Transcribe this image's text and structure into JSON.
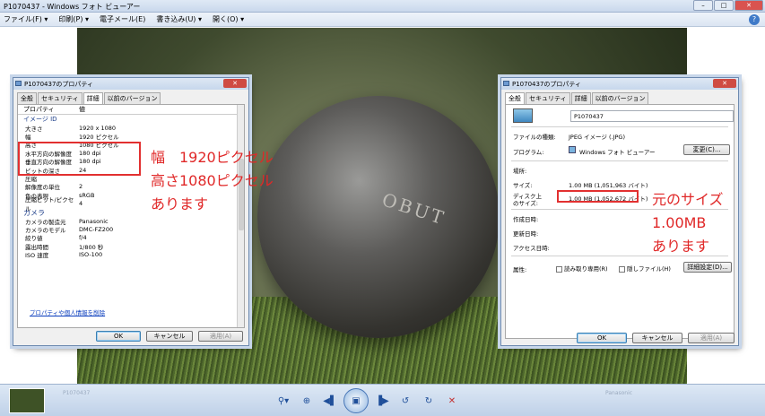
{
  "window": {
    "title": "P1070437 - Windows フォト ビューアー"
  },
  "menu": [
    {
      "label": "ファイル(F) ▾"
    },
    {
      "label": "印刷(P) ▾"
    },
    {
      "label": "電子メール(E)"
    },
    {
      "label": "書き込み(U) ▾"
    },
    {
      "label": "開く(O) ▾"
    }
  ],
  "dialog_left": {
    "title": "P1070437のプロパティ",
    "tabs": [
      "全般",
      "セキュリティ",
      "詳細",
      "以前のバージョン"
    ],
    "active_tab": 2,
    "header": {
      "property": "プロパティ",
      "value": "値"
    },
    "rows": [
      {
        "section": "イメージ ID"
      },
      {
        "name": "大きさ",
        "value": "1920 x 1080"
      },
      {
        "name": "幅",
        "value": "1920 ピクセル"
      },
      {
        "name": "高さ",
        "value": "1080 ピクセル"
      },
      {
        "name": "水平方向の解像度",
        "value": "180 dpi"
      },
      {
        "name": "垂直方向の解像度",
        "value": "180 dpi"
      },
      {
        "name": "ビットの深さ",
        "value": "24"
      },
      {
        "name": "圧縮",
        "value": ""
      },
      {
        "name": "解像度の単位",
        "value": "2"
      },
      {
        "name": "色の表現",
        "value": "sRGB"
      },
      {
        "name": "圧縮ビット/ピクセル",
        "value": "4"
      },
      {
        "camera": "カメラ"
      },
      {
        "name": "カメラの製造元",
        "value": "Panasonic"
      },
      {
        "name": "カメラのモデル",
        "value": "DMC-FZ200"
      },
      {
        "name": "絞り値",
        "value": "f/4"
      },
      {
        "name": "露出時間",
        "value": "1/800 秒"
      },
      {
        "name": "ISO 速度",
        "value": "ISO-100"
      }
    ],
    "privacy_link": "プロパティや個人情報を削除",
    "ok": "OK",
    "cancel": "キャンセル",
    "apply": "適用(A)"
  },
  "annotation_left": [
    "幅　1920ピクセル",
    "高さ1080ピクセル",
    "あります"
  ],
  "dialog_right": {
    "title": "P1070437のプロパティ",
    "tabs": [
      "全般",
      "セキュリティ",
      "詳細",
      "以前のバージョン"
    ],
    "active_tab": 0,
    "filename": "P1070437",
    "file_type_label": "ファイルの種類:",
    "file_type_value": "JPEG イメージ (.JPG)",
    "program_label": "プログラム:",
    "program_value": "Windows フォト ビューアー",
    "change_button": "変更(C)...",
    "location_label": "場所:",
    "size_label": "サイズ:",
    "size_value": "1.00 MB (1,051,963 バイト)",
    "disk_size_label1": "ディスク上",
    "disk_size_label2": "のサイズ:",
    "disk_size_value": "1.00 MB (1,052,672 バイト)",
    "created_label": "作成日時:",
    "modified_label": "更新日時:",
    "accessed_label": "アクセス日時:",
    "attributes_label": "属性:",
    "readonly_label": "読み取り専用(R)",
    "hidden_label": "隠しファイル(H)",
    "advanced_button": "詳細設定(D)...",
    "ok": "OK",
    "cancel": "キャンセル",
    "apply": "適用(A)"
  },
  "annotation_right": [
    "元のサイズ",
    "1.00MB",
    "あります"
  ],
  "photo": {
    "mark_text": "OBUT"
  },
  "bottom": {
    "faint_text_left": "P1070437",
    "faint_text_right": "Panasonic"
  },
  "toolbar_icons": [
    "zoom-icon",
    "fit-icon",
    "previous-icon",
    "slideshow-icon",
    "next-icon",
    "rotate-left-icon",
    "rotate-right-icon",
    "delete-icon"
  ],
  "colors": {
    "annotation": "#e02828",
    "highlight_box": "#e23030"
  }
}
